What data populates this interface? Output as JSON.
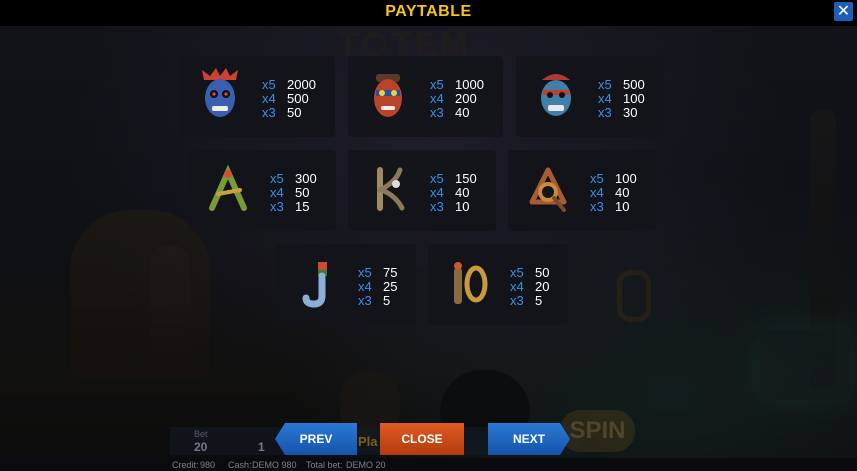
{
  "title": "PAYTABLE",
  "close_icon": "close-icon",
  "background_logo": "TOTEM",
  "symbols": [
    {
      "name": "blue-tiki-mask-symbol",
      "pays": [
        {
          "mult": "x5",
          "value": "2000"
        },
        {
          "mult": "x4",
          "value": "500"
        },
        {
          "mult": "x3",
          "value": "50"
        }
      ]
    },
    {
      "name": "red-tiki-mask-symbol",
      "pays": [
        {
          "mult": "x5",
          "value": "1000"
        },
        {
          "mult": "x4",
          "value": "200"
        },
        {
          "mult": "x3",
          "value": "40"
        }
      ]
    },
    {
      "name": "teal-tiki-mask-symbol",
      "pays": [
        {
          "mult": "x5",
          "value": "500"
        },
        {
          "mult": "x4",
          "value": "100"
        },
        {
          "mult": "x3",
          "value": "30"
        }
      ]
    },
    {
      "name": "letter-a-symbol",
      "pays": [
        {
          "mult": "x5",
          "value": "300"
        },
        {
          "mult": "x4",
          "value": "50"
        },
        {
          "mult": "x3",
          "value": "15"
        }
      ]
    },
    {
      "name": "letter-k-symbol",
      "pays": [
        {
          "mult": "x5",
          "value": "150"
        },
        {
          "mult": "x4",
          "value": "40"
        },
        {
          "mult": "x3",
          "value": "10"
        }
      ]
    },
    {
      "name": "letter-q-symbol",
      "pays": [
        {
          "mult": "x5",
          "value": "100"
        },
        {
          "mult": "x4",
          "value": "40"
        },
        {
          "mult": "x3",
          "value": "10"
        }
      ]
    },
    {
      "name": "letter-j-symbol",
      "pays": [
        {
          "mult": "x5",
          "value": "75"
        },
        {
          "mult": "x4",
          "value": "25"
        },
        {
          "mult": "x3",
          "value": "5"
        }
      ]
    },
    {
      "name": "ten-symbol",
      "pays": [
        {
          "mult": "x5",
          "value": "50"
        },
        {
          "mult": "x4",
          "value": "20"
        },
        {
          "mult": "x3",
          "value": "5"
        }
      ]
    }
  ],
  "buttons": {
    "prev": "PREV",
    "close": "CLOSE",
    "next": "NEXT"
  },
  "hud": {
    "bet_label": "Bet",
    "bet_value": "20",
    "lines_value": "1",
    "play_partial": "Pla",
    "spin": "SPIN"
  },
  "status": {
    "credit_label": "Credit:",
    "credit_value": "980",
    "cash_label": "Cash:",
    "cash_value": "DEMO 980",
    "total_bet_label": "Total bet:",
    "total_bet_value": "DEMO 20"
  },
  "colors": {
    "title": "#f5c518",
    "multiplier": "#3b8fe8",
    "nav_button": "#1d63be",
    "close_button": "#c9481a"
  }
}
